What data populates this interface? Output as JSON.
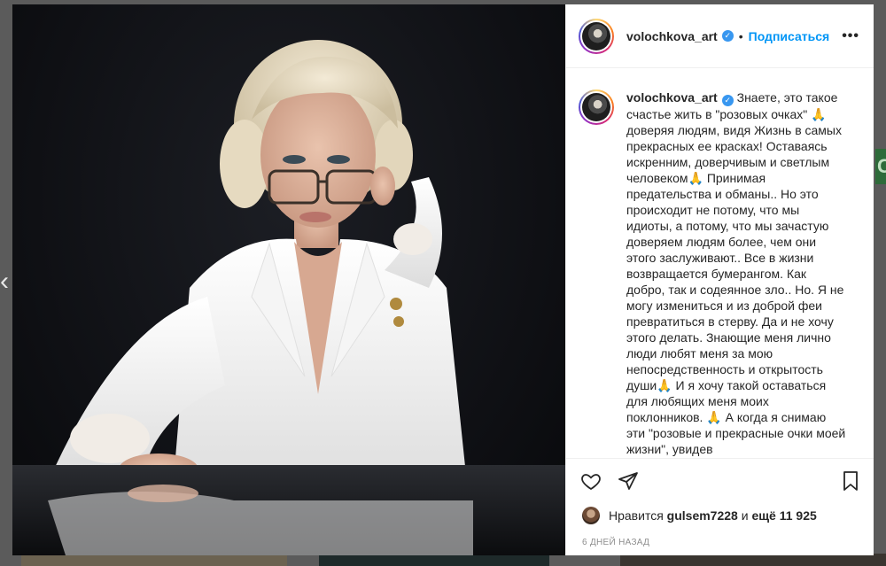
{
  "post": {
    "username": "volochkova_art",
    "follow_label": "Подписаться",
    "more_label": "•••",
    "caption_parts": [
      "Знаете, это такое счастье жить в \"розовых очках\" ",
      " доверяя людям, видя Жизнь в самых прекрасных ее красках! Оставаясь искренним, доверчивым и светлым человеком",
      " Принимая предательства и обманы.. Но это происходит не потому, что мы идиоты, а потому, что мы зачастую доверяем людям более, чем они этого заслуживают.. Все в жизни возвращается бумерангом. Как добро, так и содеянное зло.. Но. Я не могу измениться и из доброй феи превратиться в стерву. Да и не хочу этого делать. Знающие меня лично люди любят меня за мою непосредственность и открытость души",
      " И я хочу такой оставаться для любящих меня моих поклонников. ",
      " А когда я снимаю эти \"розовые и прекрасные очки моей жизни\", увидев"
    ],
    "emoji": "🙏",
    "likes_prefix": "Нравится",
    "likes_user": "gulsem7228",
    "likes_conj": "и",
    "likes_rest": "ещё 11 925",
    "date": "6 ДНЕЙ НАЗАД"
  },
  "icons": {
    "verified": "verified-badge-icon",
    "like": "heart-icon",
    "share": "paper-plane-icon",
    "save": "bookmark-icon",
    "prev": "chevron-left-icon"
  },
  "colors": {
    "link": "#0095f6",
    "verified": "#3897f0",
    "text": "#262626",
    "muted": "#8e8e8e"
  }
}
